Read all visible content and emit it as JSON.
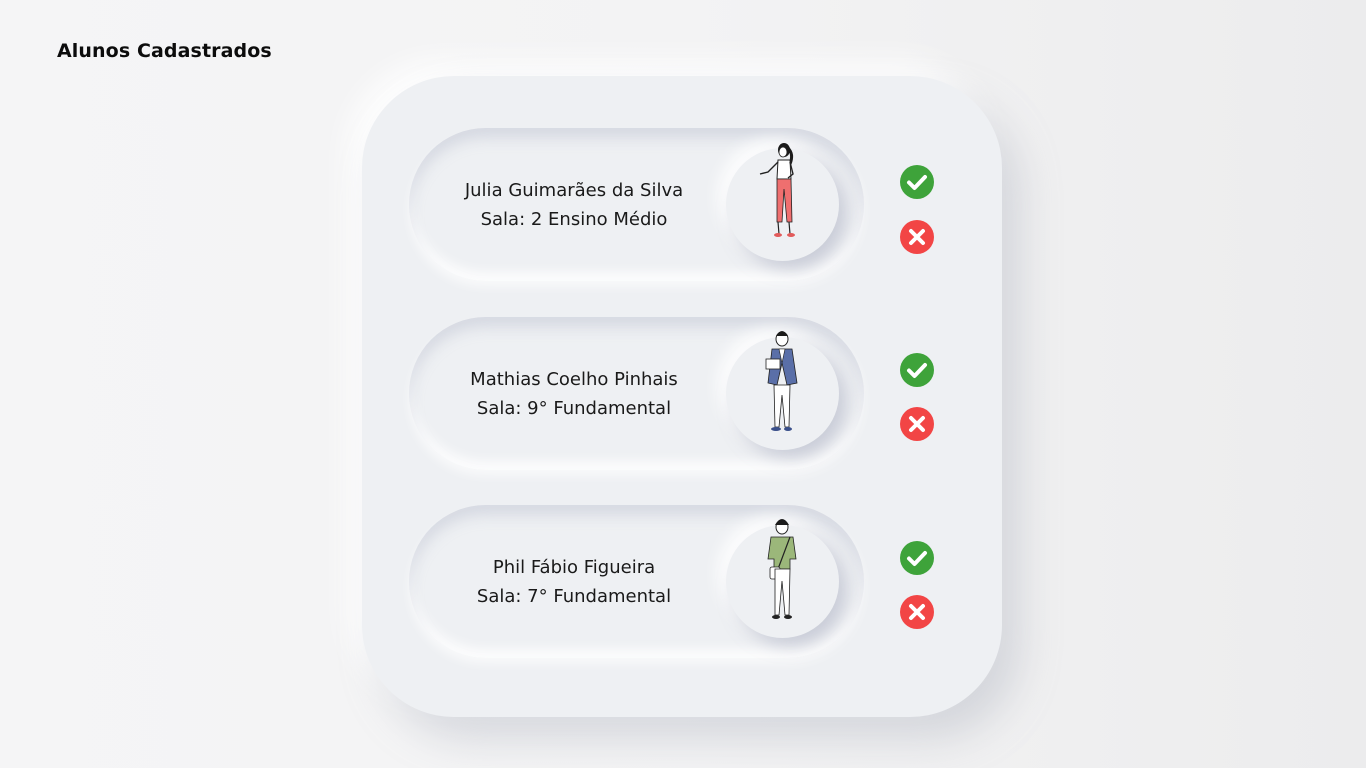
{
  "page": {
    "title": "Alunos Cadastrados"
  },
  "students": [
    {
      "name": "Julia Guimarães da Silva",
      "room": "Sala: 2 Ensino Médio",
      "avatar": "woman-pink-pants-illustration"
    },
    {
      "name": "Mathias Coelho Pinhais",
      "room": "Sala: 9° Fundamental",
      "avatar": "man-blue-blazer-illustration"
    },
    {
      "name": "Phil Fábio Figueira",
      "room": "Sala: 7° Fundamental",
      "avatar": "man-green-shirt-illustration"
    }
  ],
  "actions": {
    "approve_icon": "check-circle-icon",
    "reject_icon": "x-circle-icon"
  },
  "colors": {
    "approve": "#3ea33a",
    "reject": "#f24545",
    "surface": "#eef0f3"
  }
}
